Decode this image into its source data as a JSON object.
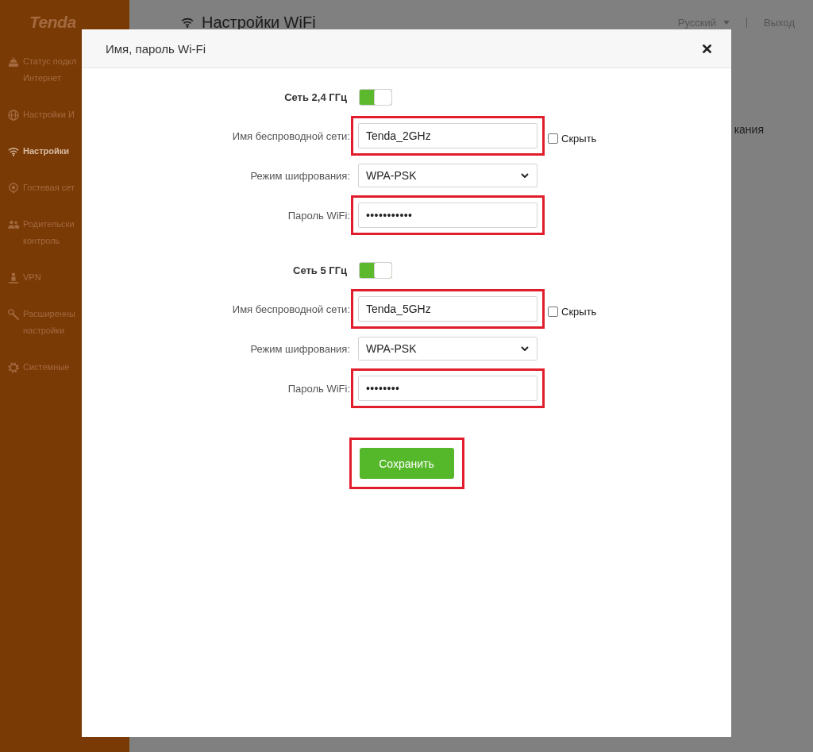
{
  "sidebar": {
    "logo": "Tenda",
    "items": [
      {
        "lines": [
          "Статус подкл",
          "Интернет"
        ],
        "selected": false
      },
      {
        "lines": [
          "Настройки И"
        ],
        "selected": false
      },
      {
        "lines": [
          "Настройки"
        ],
        "selected": true
      },
      {
        "lines": [
          "Гостевая сет"
        ],
        "selected": false
      },
      {
        "lines": [
          "Родительски",
          "контроль"
        ],
        "selected": false
      },
      {
        "lines": [
          "VPN"
        ],
        "selected": false
      },
      {
        "lines": [
          "Расширенны",
          "настройки"
        ],
        "selected": false
      },
      {
        "lines": [
          "Системные"
        ],
        "selected": false
      }
    ]
  },
  "header": {
    "title": "Настройки WiFi",
    "language": "Русский",
    "logout": "Выход"
  },
  "page": {
    "text_fragment": "кания"
  },
  "dialog": {
    "title": "Имя, пароль Wi-Fi",
    "sections": [
      {
        "title": "Сеть 2,4 ГГц",
        "enabled": true,
        "fields": [
          {
            "kind": "text",
            "label": "Имя беспроводной сети:",
            "value": "Tenda_2GHz",
            "highlighted": true,
            "checkbox": {
              "label": "Скрыть",
              "checked": false
            }
          },
          {
            "kind": "select",
            "label": "Режим шифрования:",
            "value": "WPA-PSK",
            "highlighted": false
          },
          {
            "kind": "password",
            "label": "Пароль WiFi:",
            "value": "•••••••••••",
            "highlighted": true
          }
        ]
      },
      {
        "title": "Сеть 5 ГГц",
        "enabled": true,
        "fields": [
          {
            "kind": "text",
            "label": "Имя беспроводной сети:",
            "value": "Tenda_5GHz",
            "highlighted": true,
            "checkbox": {
              "label": "Скрыть",
              "checked": false
            }
          },
          {
            "kind": "select",
            "label": "Режим шифрования:",
            "value": "WPA-PSK",
            "highlighted": false
          },
          {
            "kind": "password",
            "label": "Пароль WiFi:",
            "value": "••••••••",
            "highlighted": true
          }
        ]
      }
    ],
    "save_button": {
      "label": "Сохранить",
      "highlighted": true
    }
  }
}
